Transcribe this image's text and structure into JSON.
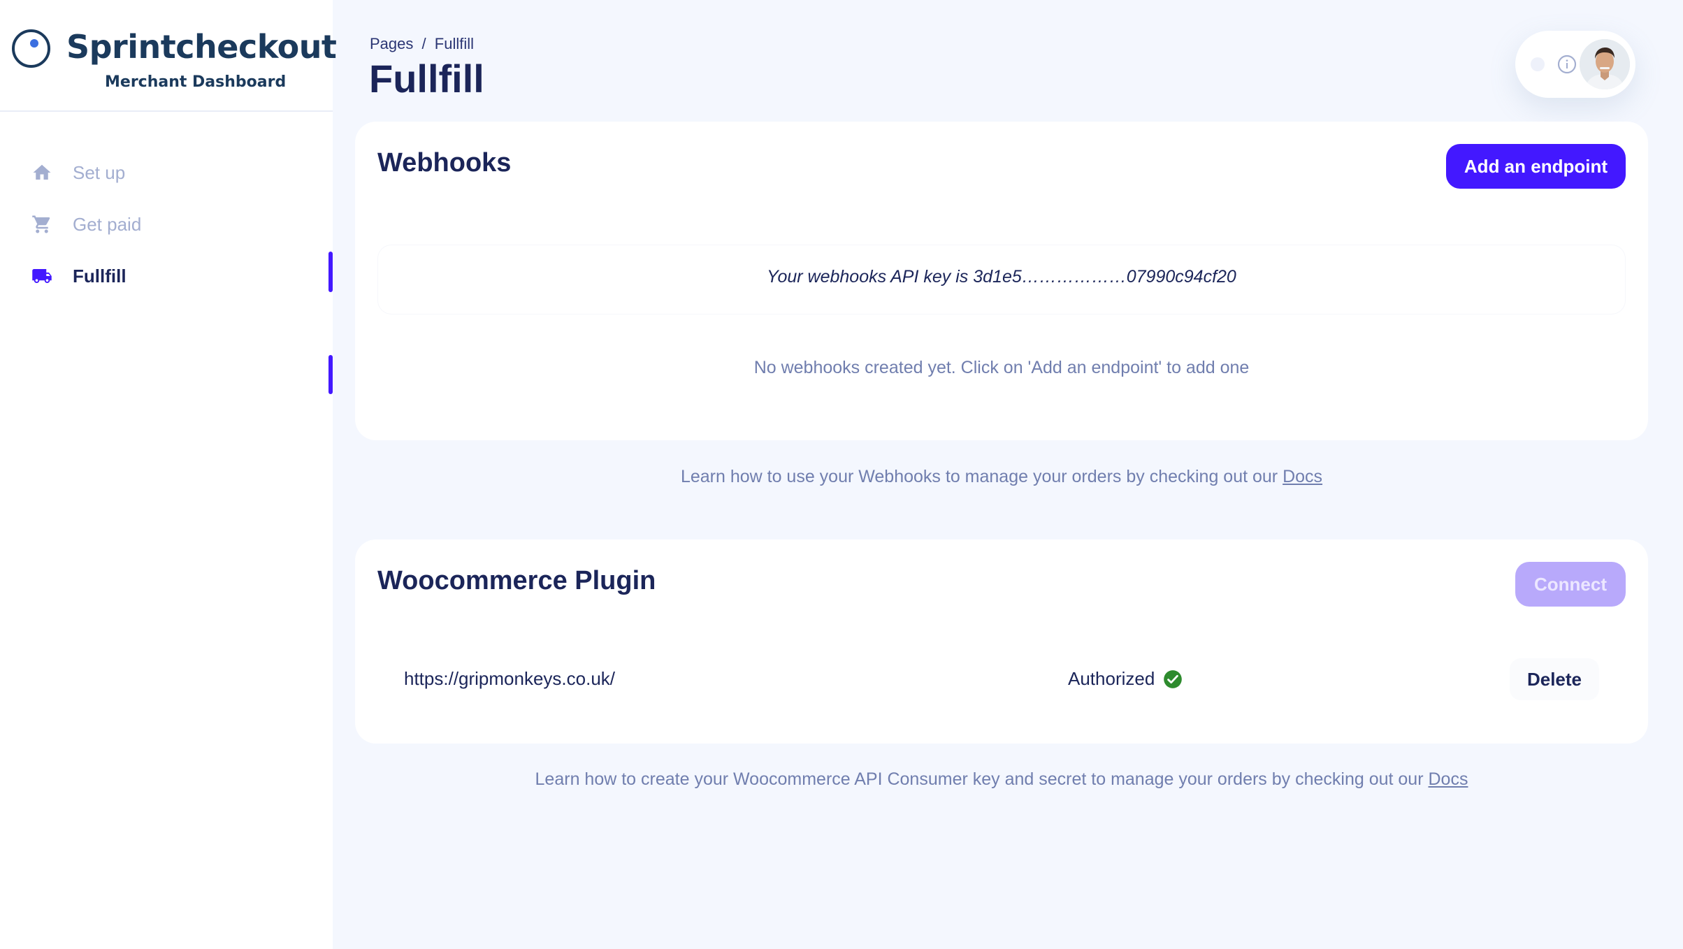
{
  "brand": {
    "title": "Sprintcheckout",
    "subtitle": "Merchant Dashboard"
  },
  "nav": {
    "items": [
      {
        "label": "Set up",
        "icon": "home-icon"
      },
      {
        "label": "Get paid",
        "icon": "cart-icon"
      },
      {
        "label": "Fullfill",
        "icon": "truck-icon",
        "active": true
      }
    ]
  },
  "header": {
    "breadcrumb": [
      "Pages",
      "/",
      "Fullfill"
    ],
    "title": "Fullfill"
  },
  "webhooks": {
    "title": "Webhooks",
    "add_button": "Add an endpoint",
    "api_key_text": "Your webhooks API key is 3d1e5………………07990c94cf20",
    "empty_message": "No webhooks created yet. Click on 'Add an endpoint' to add one",
    "docs_text": "Learn how to use your Webhooks to manage your orders by checking out our",
    "docs_link": "Docs"
  },
  "woocommerce": {
    "title": "Woocommerce Plugin",
    "connect_button": "Connect",
    "store_url": "https://gripmonkeys.co.uk/",
    "status": "Authorized",
    "delete_button": "Delete",
    "docs_text": "Learn how to create your Woocommerce API Consumer key and secret to manage your orders by checking out our",
    "docs_link": "Docs"
  },
  "colors": {
    "accent": "#4318ff",
    "success": "#2e8b2e",
    "text": "#1b2559",
    "muted": "#a3aed0"
  }
}
